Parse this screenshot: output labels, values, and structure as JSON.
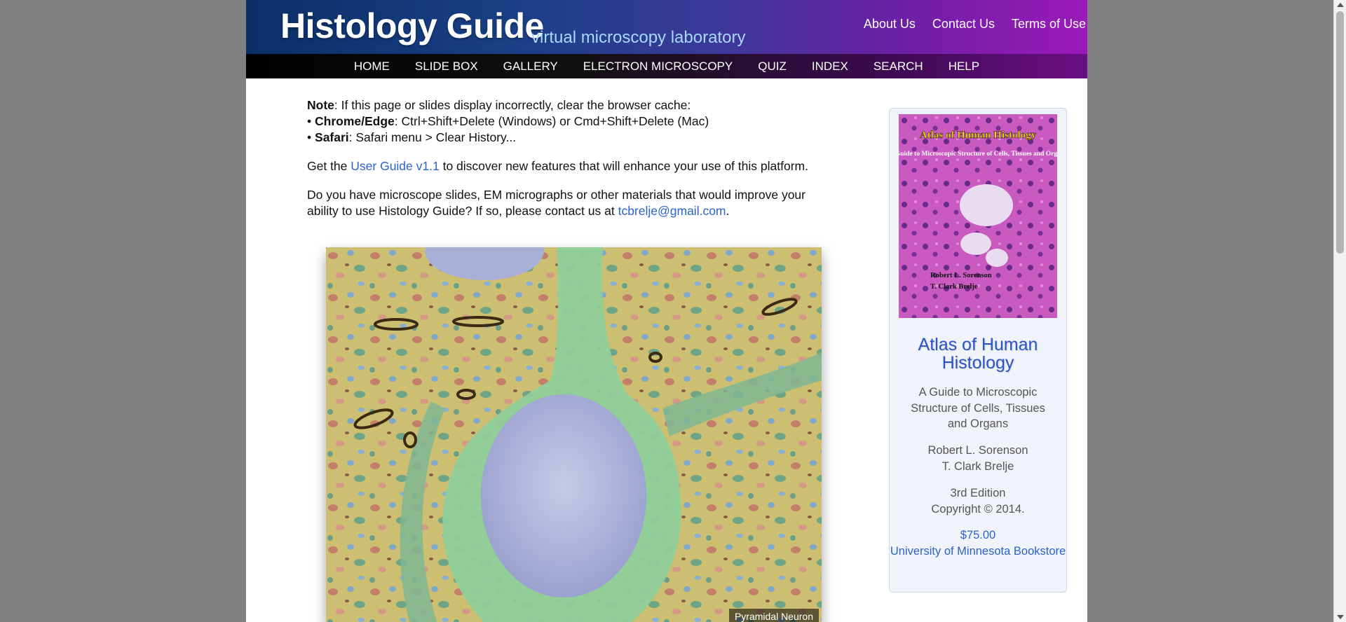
{
  "header": {
    "site_title": "Histology Guide",
    "site_subtitle": "virtual microscopy laboratory",
    "top_links": [
      "About Us",
      "Contact Us",
      "Terms of Use"
    ]
  },
  "nav": {
    "items": [
      "HOME",
      "SLIDE BOX",
      "GALLERY",
      "ELECTRON MICROSCOPY",
      "QUIZ",
      "INDEX",
      "SEARCH",
      "HELP"
    ]
  },
  "notice": {
    "note_label": "Note",
    "note_text": ": If this page or slides display incorrectly, clear the browser cache:",
    "chrome_label": "Chrome/Edge",
    "chrome_text": ": Ctrl+Shift+Delete (Windows) or Cmd+Shift+Delete (Mac)",
    "safari_label": "Safari",
    "safari_text": ": Safari menu > Clear History...",
    "bullet": "•"
  },
  "guide": {
    "prefix": "Get the ",
    "link": "User Guide v1.1",
    "suffix": " to discover new features that will enhance your use of this platform."
  },
  "contact": {
    "text": "Do you have microscope slides, EM micrographs or other materials that would improve your ability to use Histology Guide? If so, please contact us at ",
    "email": "tcbrelje@gmail.com",
    "end": "."
  },
  "featured_image": {
    "caption": "Pyramidal Neuron"
  },
  "sidebar": {
    "cover_title": "Atlas of Human Histology",
    "cover_subtitle": "A Guide to Microscopic Structure of Cells, Tissues and Organs",
    "cover_author1": "Robert L. Sorenson",
    "cover_author2": "T. Clark Brelje",
    "book_title": "Atlas of Human Histology",
    "book_subtitle": "A Guide to Microscopic Structure of Cells, Tissues and Organs",
    "author1": "Robert L. Sorenson",
    "author2": "T. Clark Brelje",
    "edition": "3rd Edition",
    "copyright": "Copyright © 2014.",
    "price": "$75.00",
    "store": "University of Minnesota Bookstore"
  },
  "colors": {
    "link": "#2a63c9",
    "header_left": "#0b2f66",
    "header_right": "#9a1ab8",
    "page_bg": "#808080"
  }
}
